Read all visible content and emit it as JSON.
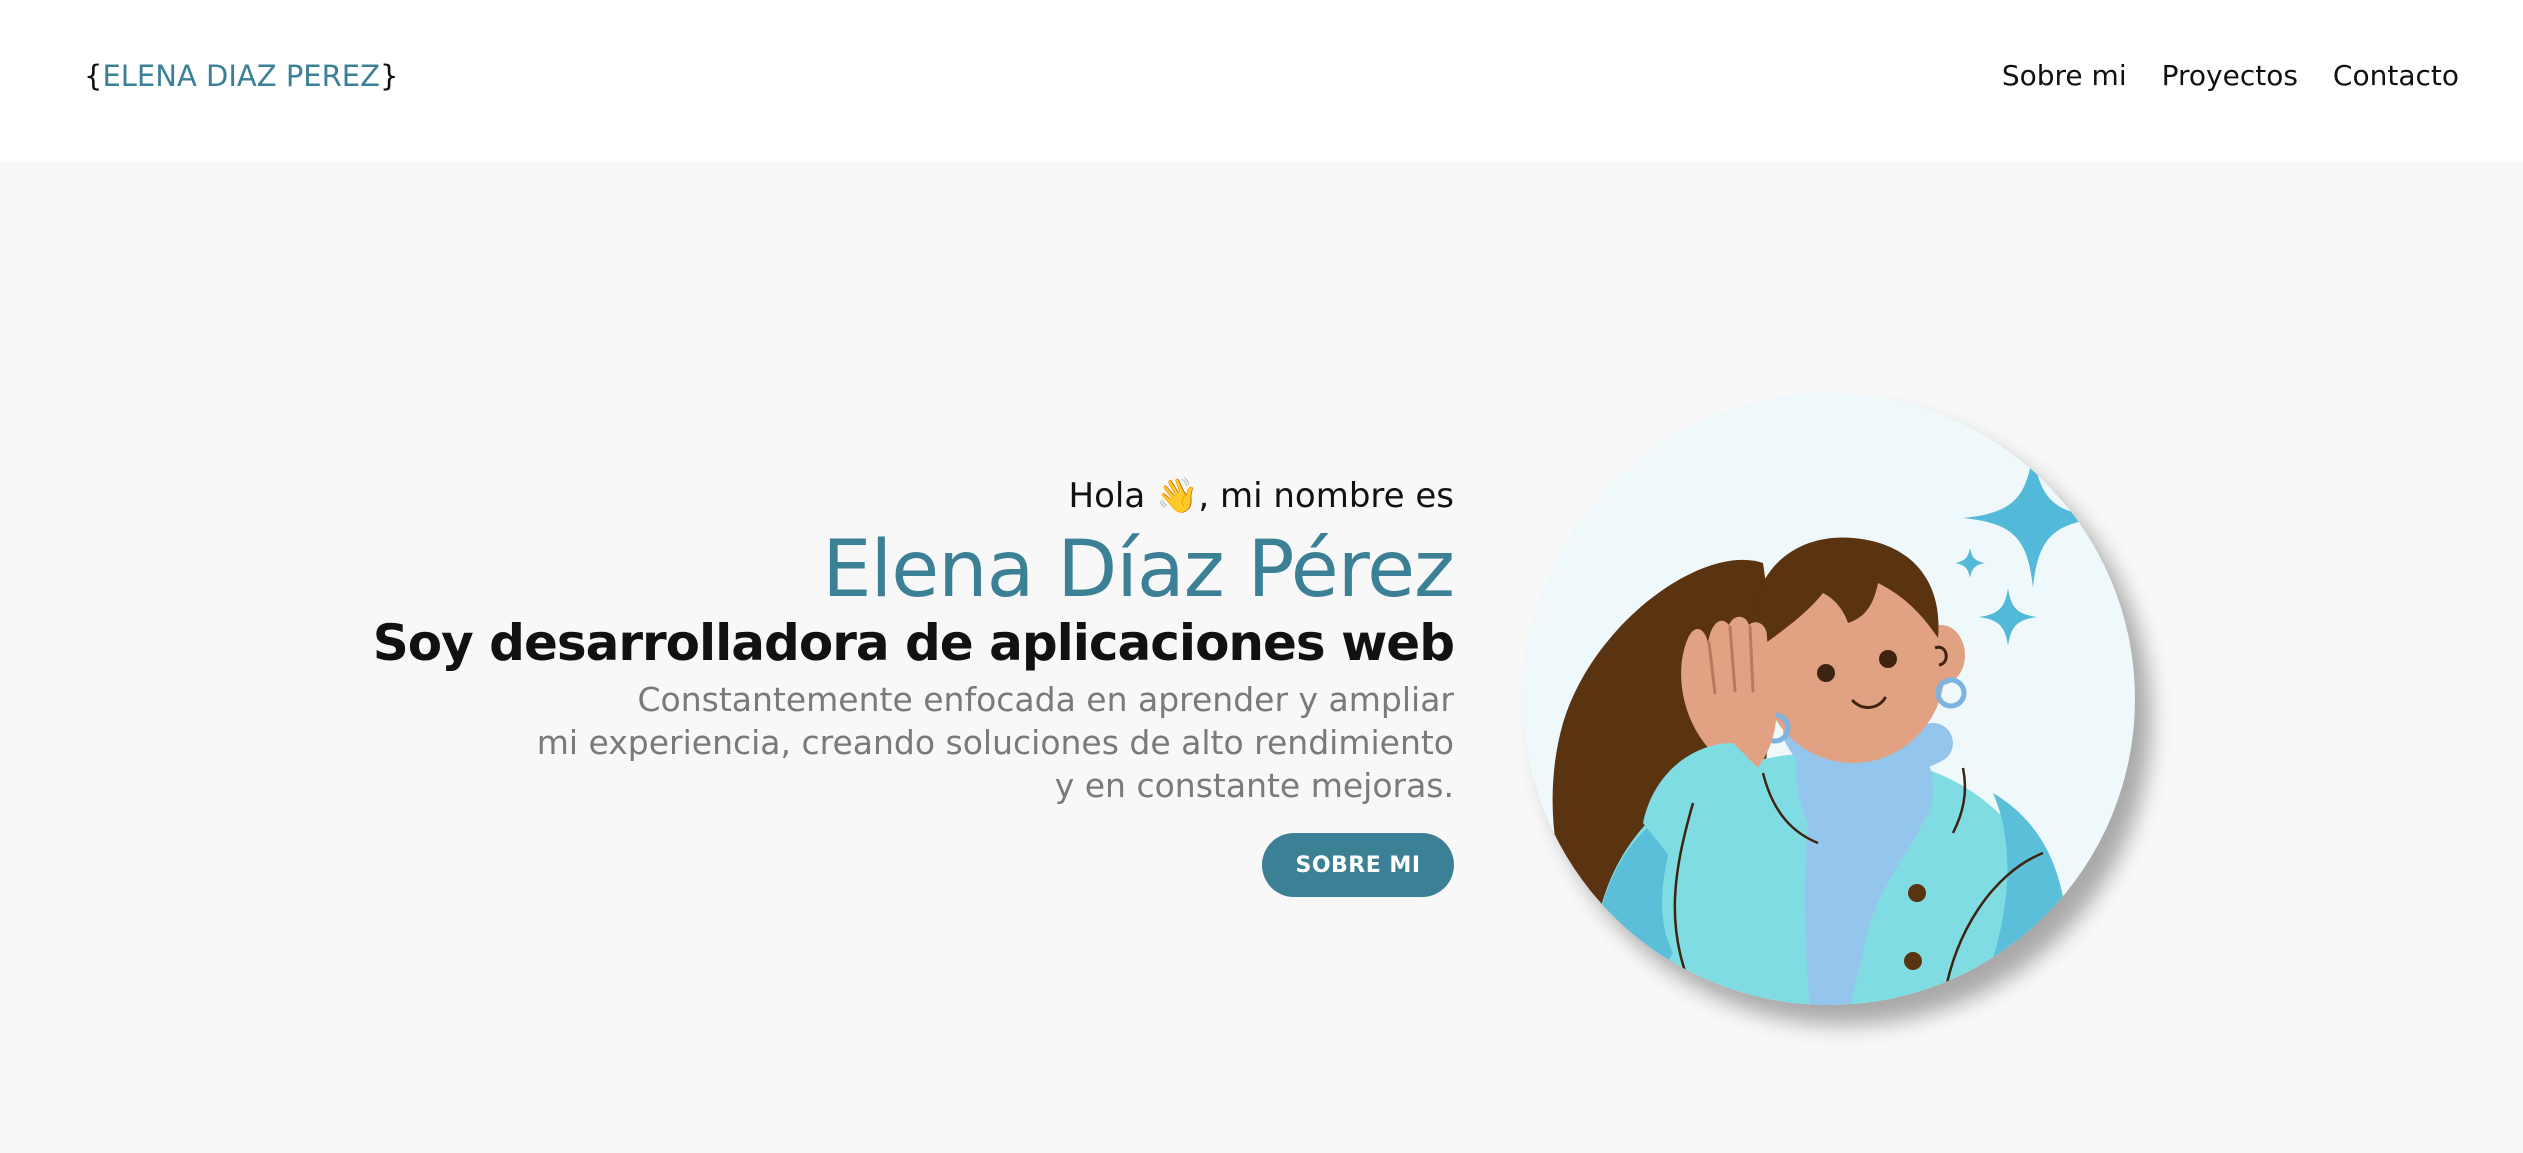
{
  "header": {
    "logo": {
      "open_brace": "{",
      "name": "ELENA DIAZ PEREZ",
      "close_brace": "}"
    },
    "nav": [
      {
        "label": "Sobre mi"
      },
      {
        "label": "Proyectos"
      },
      {
        "label": "Contacto"
      }
    ]
  },
  "hero": {
    "greeting_prefix": "Hola",
    "wave_icon": "waving-hand-icon",
    "wave_glyph": "👋",
    "greeting_suffix": ", mi nombre es",
    "name": "Elena Díaz Pérez",
    "role": "Soy desarrolladora de aplicaciones web",
    "description_lines": [
      "Constantemente enfocada en aprender y ampliar",
      "mi experiencia, creando soluciones de alto rendimiento",
      "y en constante mejoras."
    ],
    "cta_label": "SOBRE MI"
  },
  "avatar": {
    "icon": "woman-listening-illustration"
  },
  "colors": {
    "accent": "#3c8096",
    "background": "#f8f8f8",
    "header_bg": "#ffffff",
    "text": "#111111",
    "muted_text": "#7a7a7a",
    "skin": "#e0a283",
    "hair": "#5a3311",
    "jacket": "#80dce3",
    "scarf": "#94c6ed",
    "sparkle": "#53b9d8"
  }
}
